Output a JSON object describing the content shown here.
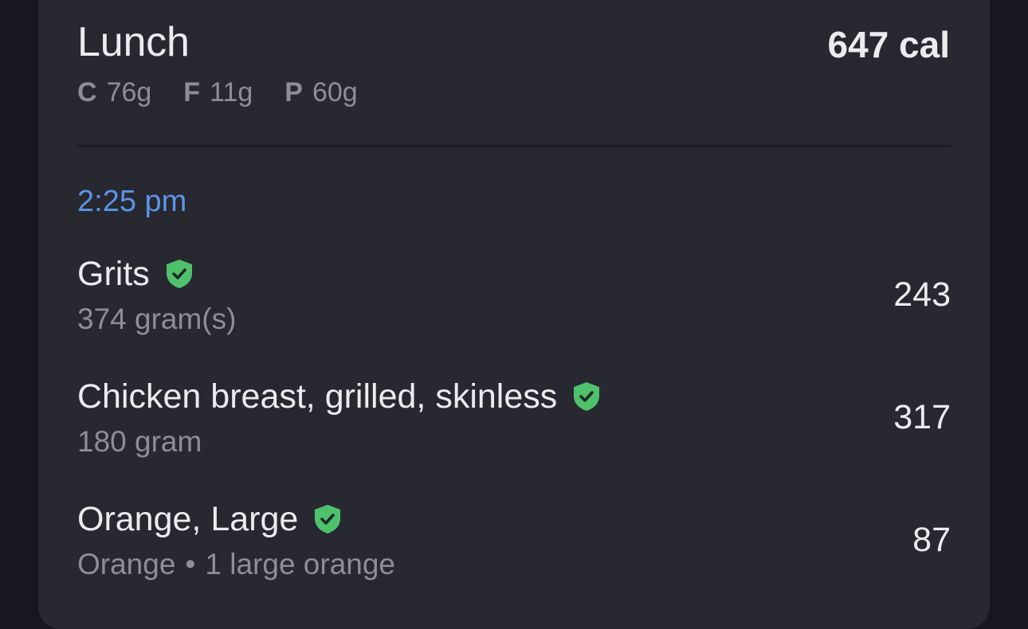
{
  "meal": {
    "title": "Lunch",
    "calories": "647 cal",
    "macros": [
      {
        "key": "C",
        "value": "76g"
      },
      {
        "key": "F",
        "value": "11g"
      },
      {
        "key": "P",
        "value": "60g"
      }
    ]
  },
  "time": "2:25 pm",
  "entries": [
    {
      "name": "Grits",
      "serving": "374 gram(s)",
      "calories": "243",
      "icon": "verified-shield-icon"
    },
    {
      "name": "Chicken breast, grilled, skinless",
      "serving": "180 gram",
      "calories": "317",
      "icon": "verified-shield-icon"
    },
    {
      "name": "Orange, Large",
      "serving_brand": "Orange",
      "serving_sep": "•",
      "serving_amount": "1 large orange",
      "calories": "87",
      "icon": "verified-shield-icon"
    }
  ],
  "colors": {
    "background": "#16171f",
    "card": "#272830",
    "accent_time": "#5b94e8",
    "verified": "#4fc16c",
    "text_primary": "#ececef",
    "text_secondary": "#8e8e95"
  }
}
